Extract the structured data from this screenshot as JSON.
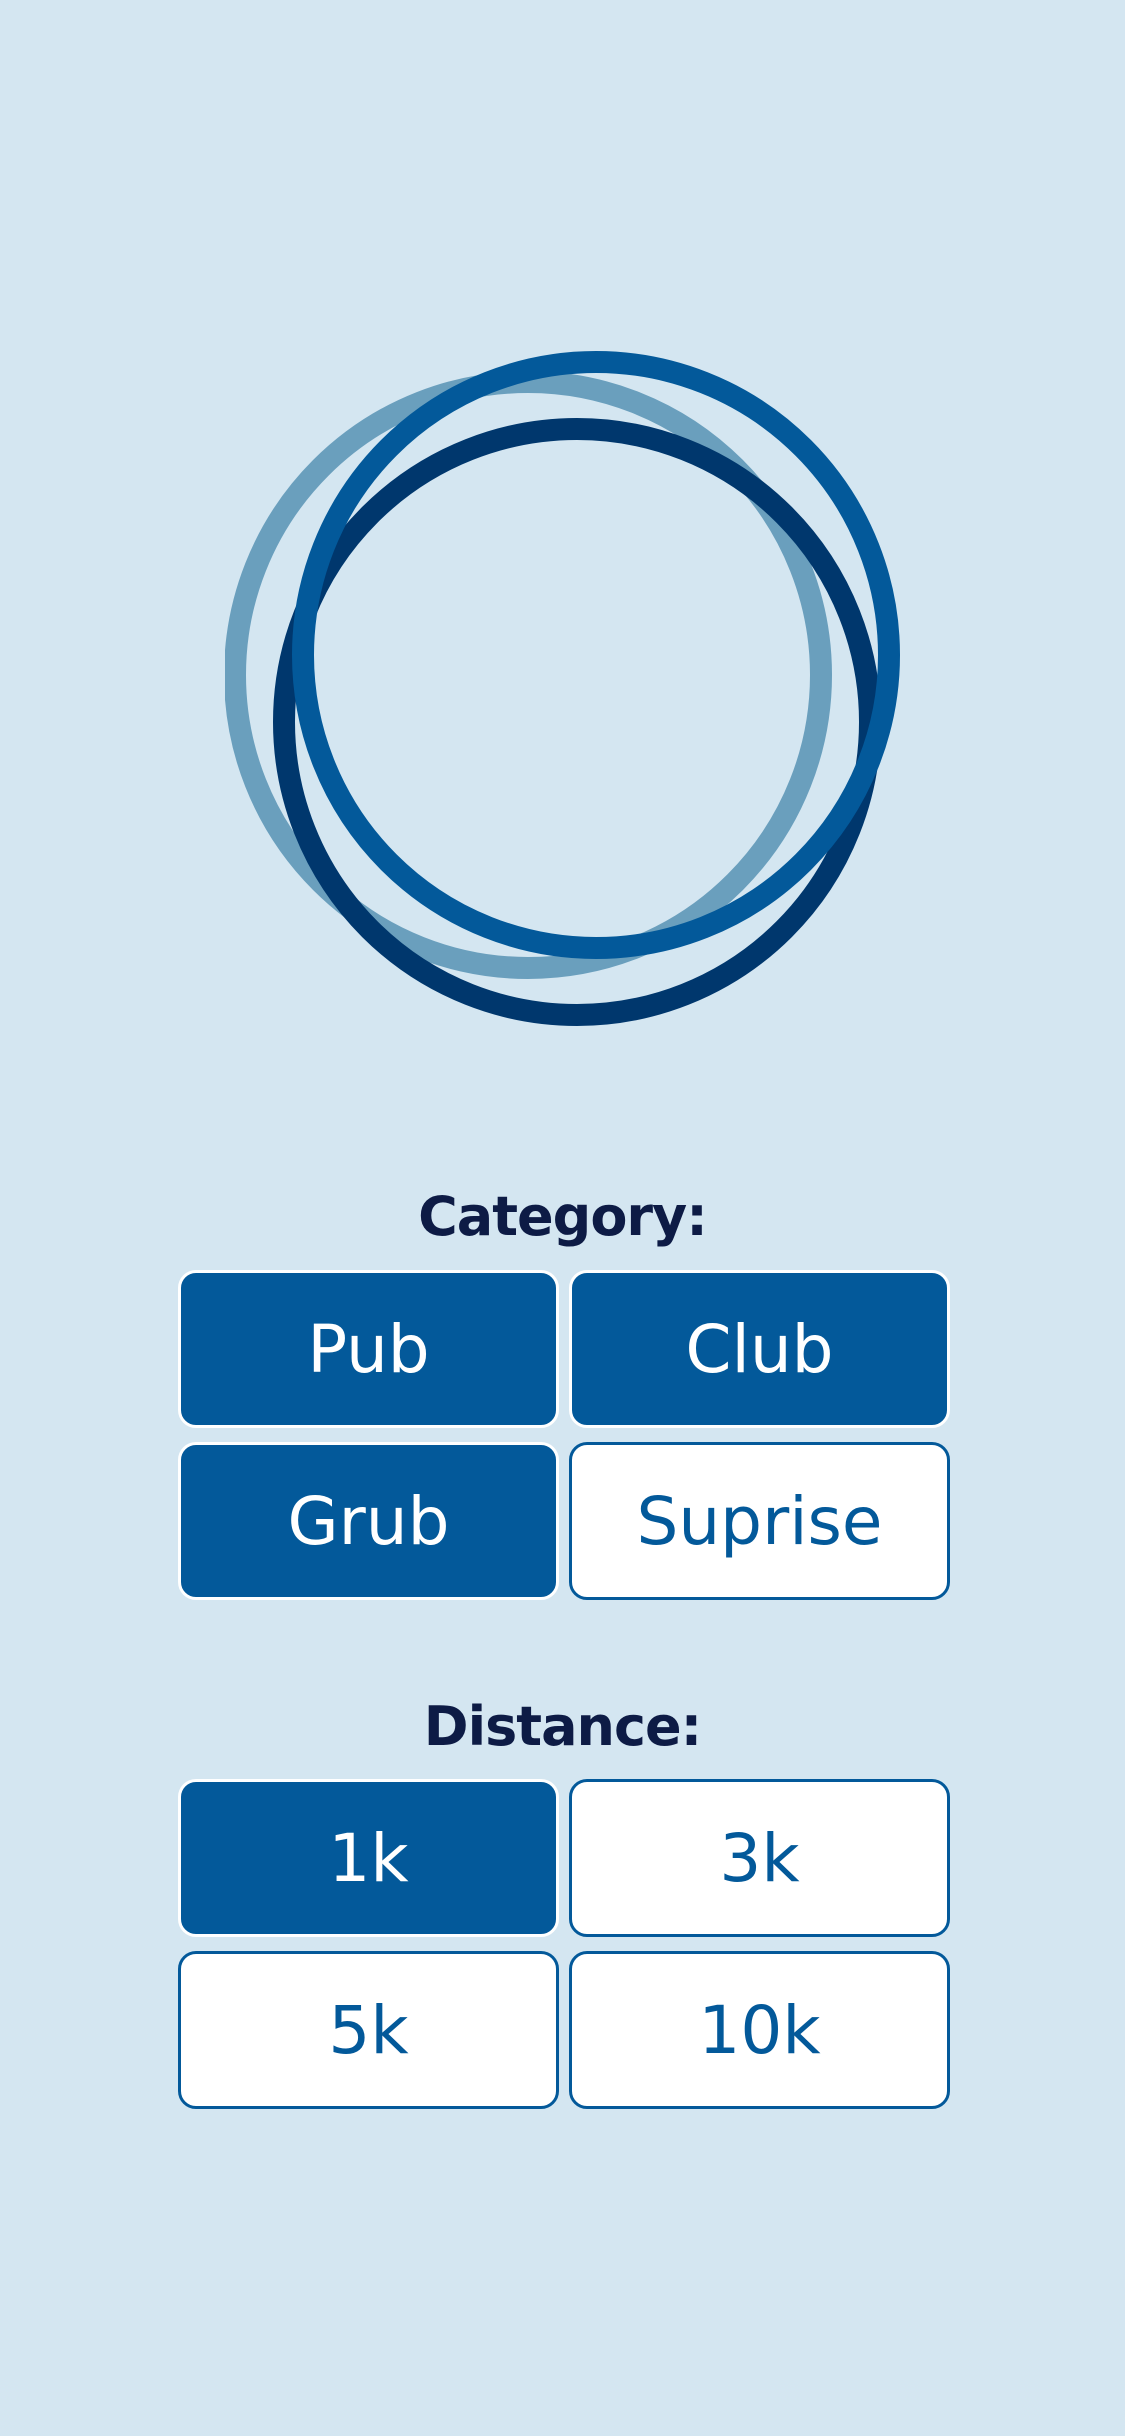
{
  "colors": {
    "background": "#d4e6f1",
    "primary": "#03599a",
    "title": "#0d1b45",
    "ring_light": "#6a9fbd",
    "ring_dark": "#00376d",
    "ring_mid": "#03599a"
  },
  "logo": {
    "icon": "three-interlocking-rings-icon"
  },
  "category": {
    "title": "Category:",
    "options": [
      {
        "label": "Pub",
        "selected": true
      },
      {
        "label": "Club",
        "selected": true
      },
      {
        "label": "Grub",
        "selected": true
      },
      {
        "label": "Suprise",
        "selected": false
      }
    ]
  },
  "distance": {
    "title": "Distance:",
    "options": [
      {
        "label": "1k",
        "selected": true
      },
      {
        "label": "3k",
        "selected": false
      },
      {
        "label": "5k",
        "selected": false
      },
      {
        "label": "10k",
        "selected": false
      }
    ]
  }
}
